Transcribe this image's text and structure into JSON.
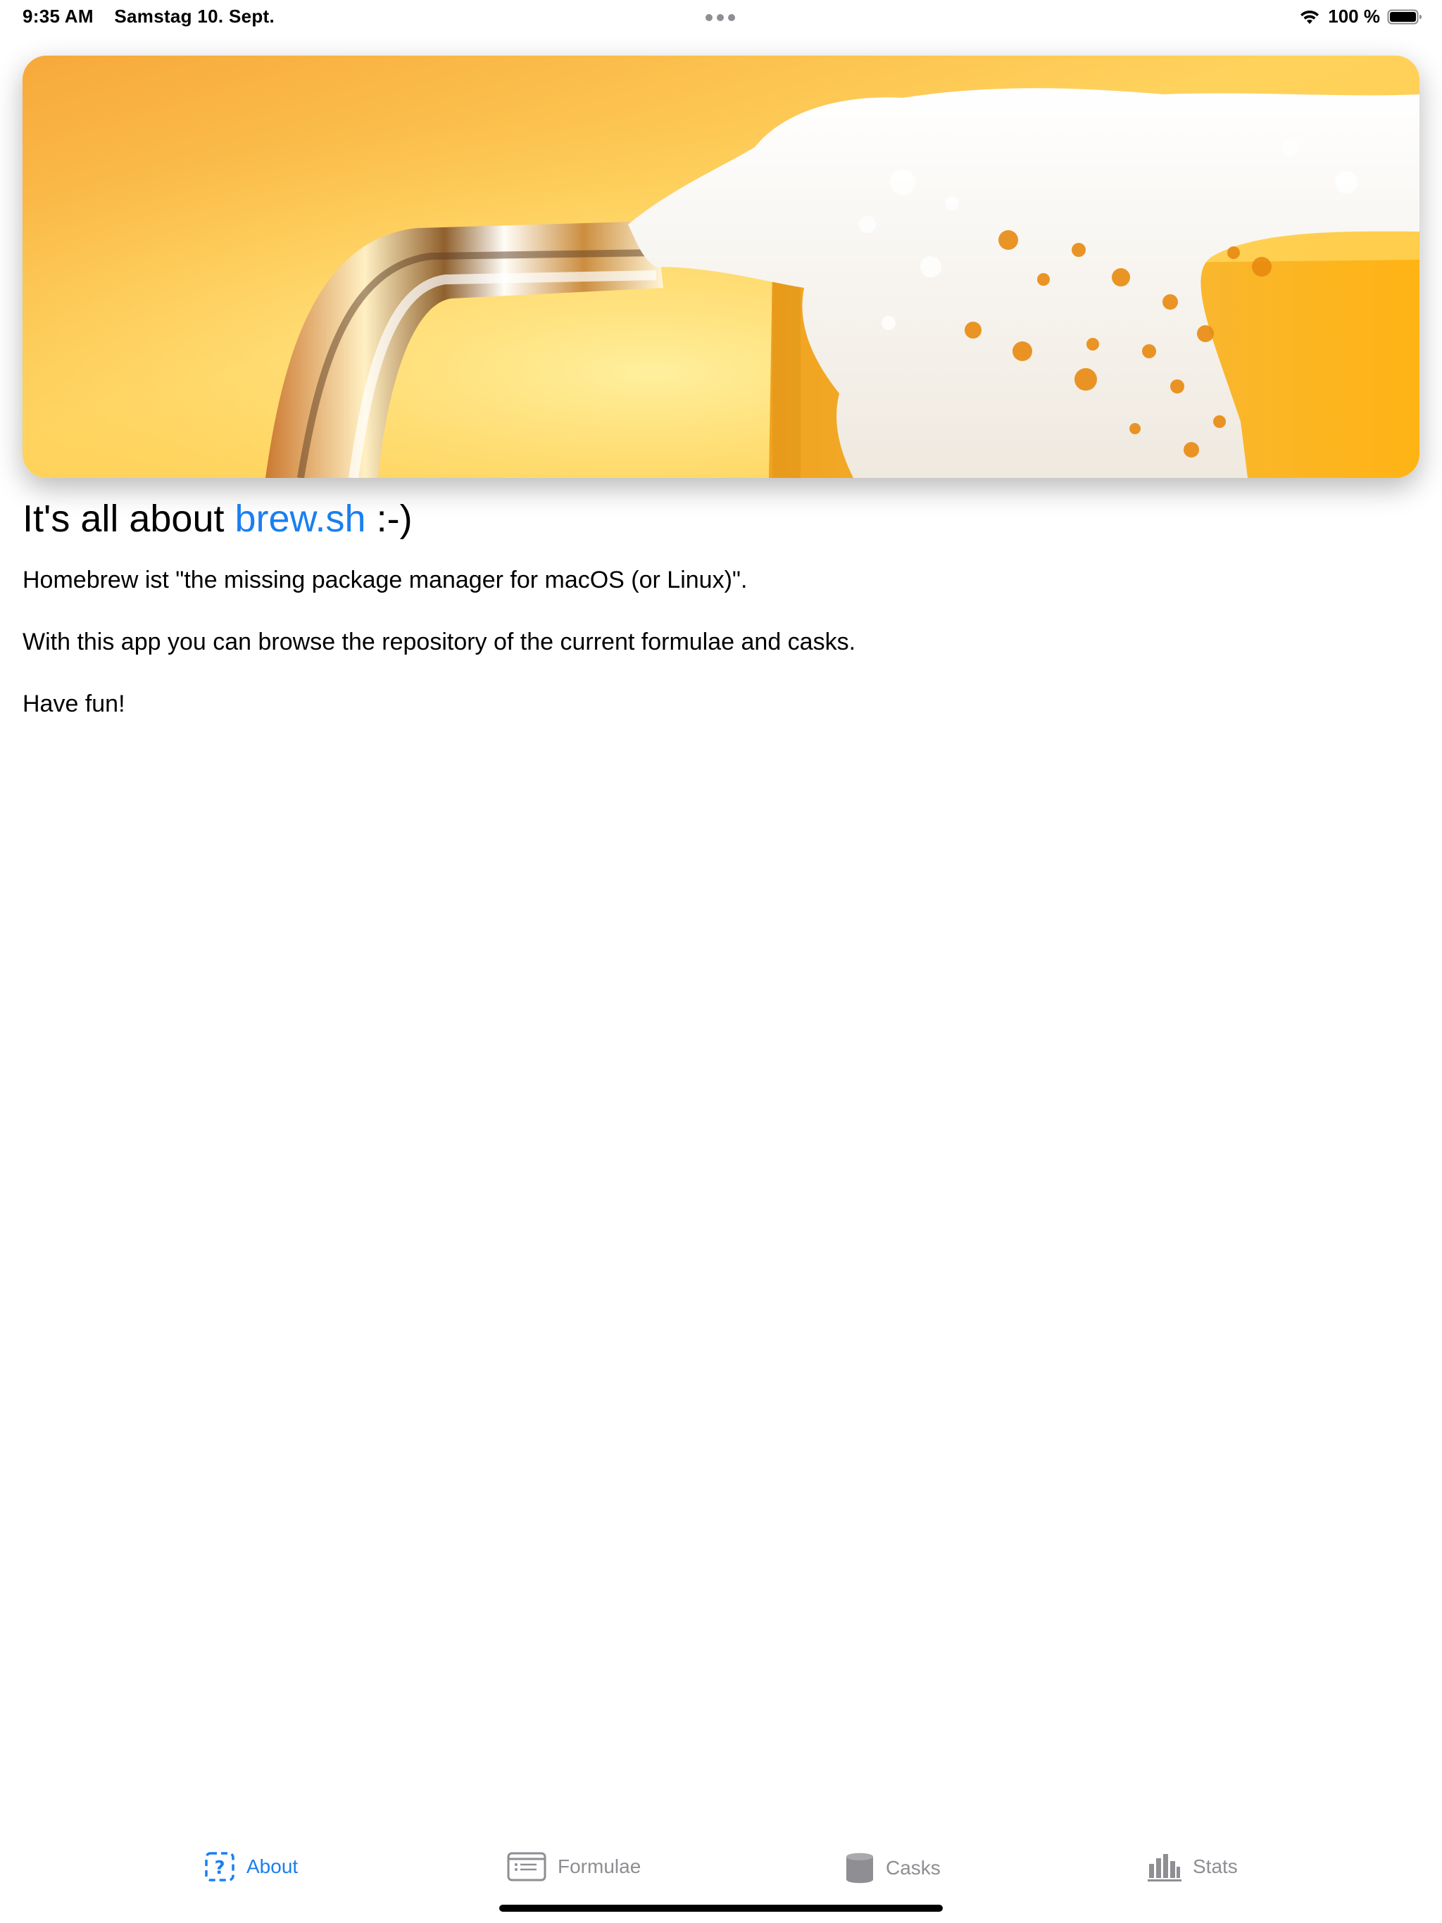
{
  "status_bar": {
    "time": "9:35 AM",
    "date": "Samstag 10. Sept.",
    "battery_text": "100 %",
    "battery_level": 1.0
  },
  "hero": {
    "image": "beer-mug-with-foam"
  },
  "about": {
    "title_prefix": "It's all about ",
    "title_link": "brew.sh",
    "title_suffix": " :-)",
    "paragraphs": [
      "Homebrew ist \"the missing package manager for macOS (or Linux)\".",
      "With this app you can browse the repository of the current formulae and casks.",
      "Have fun!"
    ]
  },
  "tab_bar": {
    "tabs": [
      {
        "label": "About",
        "icon": "question-square-icon",
        "active": true
      },
      {
        "label": "Formulae",
        "icon": "list-window-icon",
        "active": false
      },
      {
        "label": "Casks",
        "icon": "cylinder-icon",
        "active": false
      },
      {
        "label": "Stats",
        "icon": "bar-chart-icon",
        "active": false
      }
    ]
  },
  "colors": {
    "accent": "#1a7ff0",
    "inactive": "#8e8e93",
    "beer_background": "#fcc644",
    "beer": "#f39c12",
    "foam": "#f7f4ee"
  }
}
